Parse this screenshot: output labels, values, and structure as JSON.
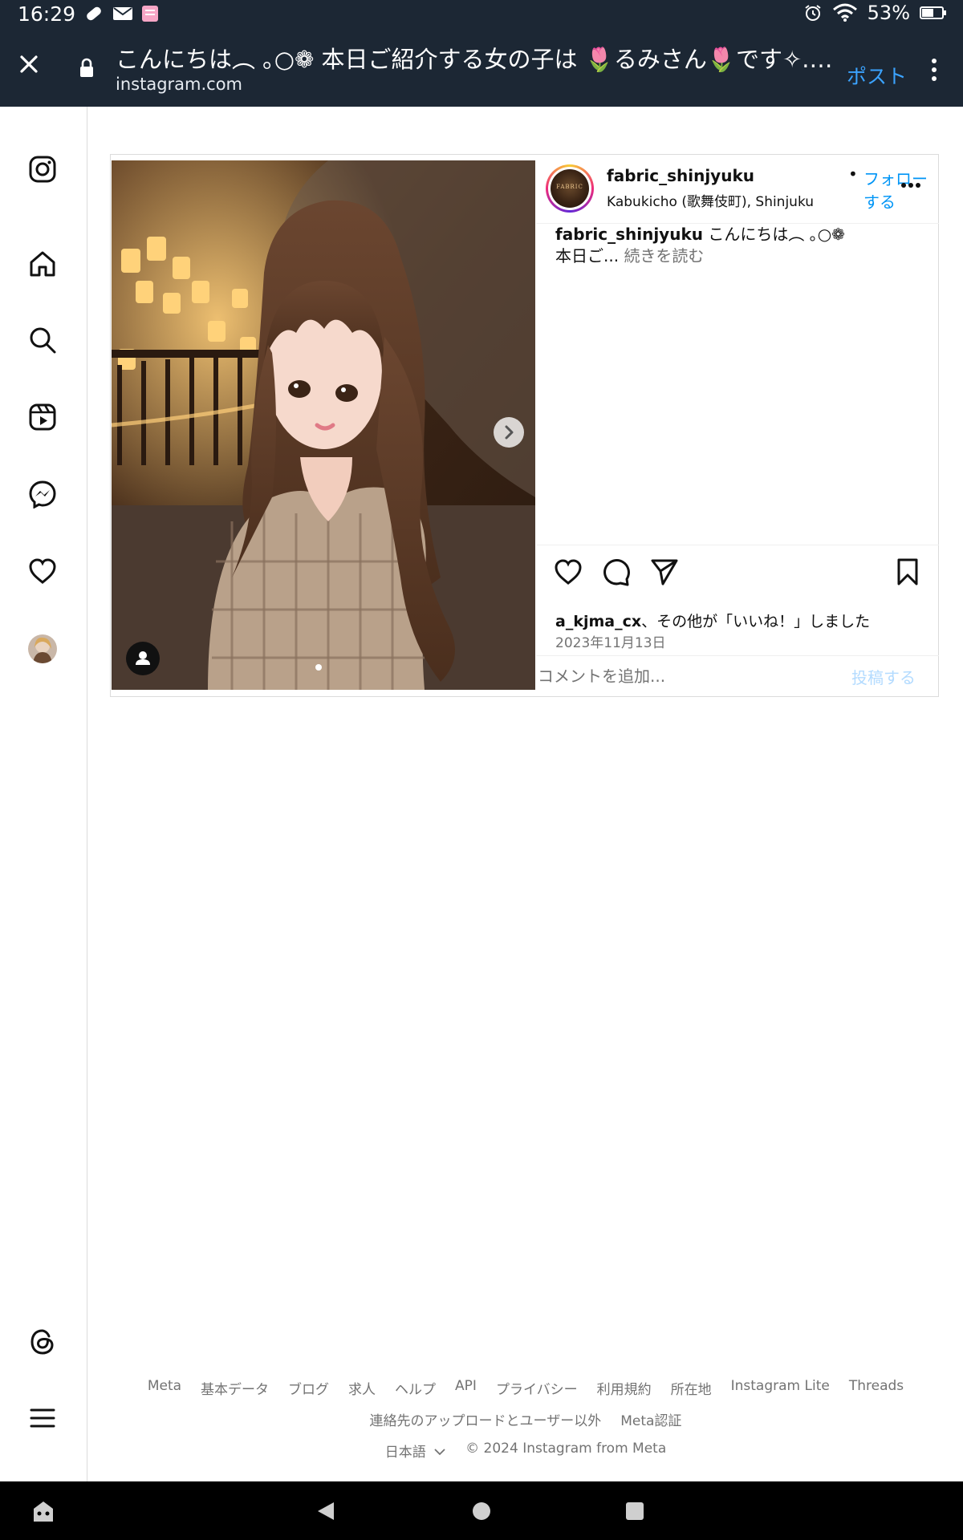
{
  "status_bar": {
    "time": "16:29",
    "battery": "53%",
    "left_icons": [
      "pill-icon",
      "mail-icon",
      "app-icon"
    ],
    "right_icons": [
      "alarm-icon",
      "wifi-icon",
      "battery-icon"
    ]
  },
  "toolbar": {
    "title": "こんにちは︵ ｡○❁ 本日ご紹介する女の子は 🌷るみさん🌷です✧.·*. @ru...",
    "url": "instagram.com",
    "post_label": "ポスト"
  },
  "nav": {
    "items": [
      "instagram-logo-icon",
      "home-icon",
      "search-icon",
      "reels-icon",
      "messenger-icon",
      "heart-icon",
      "profile-avatar",
      "threads-icon",
      "menu-icon"
    ]
  },
  "post": {
    "username": "fabric_shinjyuku",
    "separator": "•",
    "follow_label": "フォローする",
    "location": "Kabukicho (歌舞伎町), Shinjuku",
    "avatar_text": "FABRIC",
    "caption_user": "fabric_shinjyuku",
    "caption_text_line1": "こんにちは︵ ｡○❁",
    "caption_text_line2": "本日ご...",
    "read_more": "続きを読む",
    "likes_user": "a_kjma_cx",
    "likes_suffix": "、その他が「いいね！」しました",
    "date": "2023年11月13日",
    "comment_placeholder": "コメントを追加...",
    "post_button": "投稿する"
  },
  "footer": {
    "row1": [
      "Meta",
      "基本データ",
      "ブログ",
      "求人",
      "ヘルプ",
      "API",
      "プライバシー",
      "利用規約",
      "所在地",
      "Instagram Lite",
      "Threads"
    ],
    "row2": [
      "連絡先のアップロードとユーザー以外",
      "Meta認証"
    ],
    "language": "日本語",
    "copyright": "© 2024 Instagram from Meta"
  }
}
